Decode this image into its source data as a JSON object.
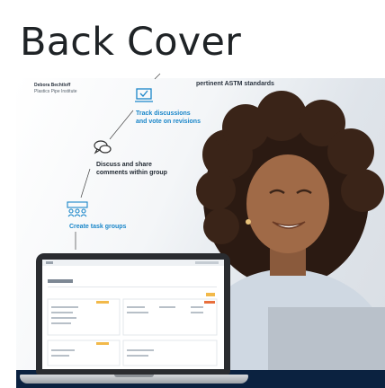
{
  "page": {
    "title": "Back Cover"
  },
  "caption": {
    "name": "Debora Bechtloff",
    "organization": "Plastics Pipe Institute",
    "standards_text": "pertinent ASTM standards"
  },
  "features": [
    {
      "label_line1": "Track discussions",
      "label_line2": "and vote on revisions",
      "icon": "checkbox-monitor-icon"
    },
    {
      "label_line1": "Discuss and share",
      "label_line2": "comments within group",
      "icon": "chat-bubbles-icon"
    },
    {
      "label_line1": "Create task groups",
      "label_line2": "",
      "icon": "people-group-icon"
    }
  ],
  "colors": {
    "accent_blue": "#1a86c9",
    "navy": "#0b2240",
    "laptop": "#2a2c30"
  }
}
